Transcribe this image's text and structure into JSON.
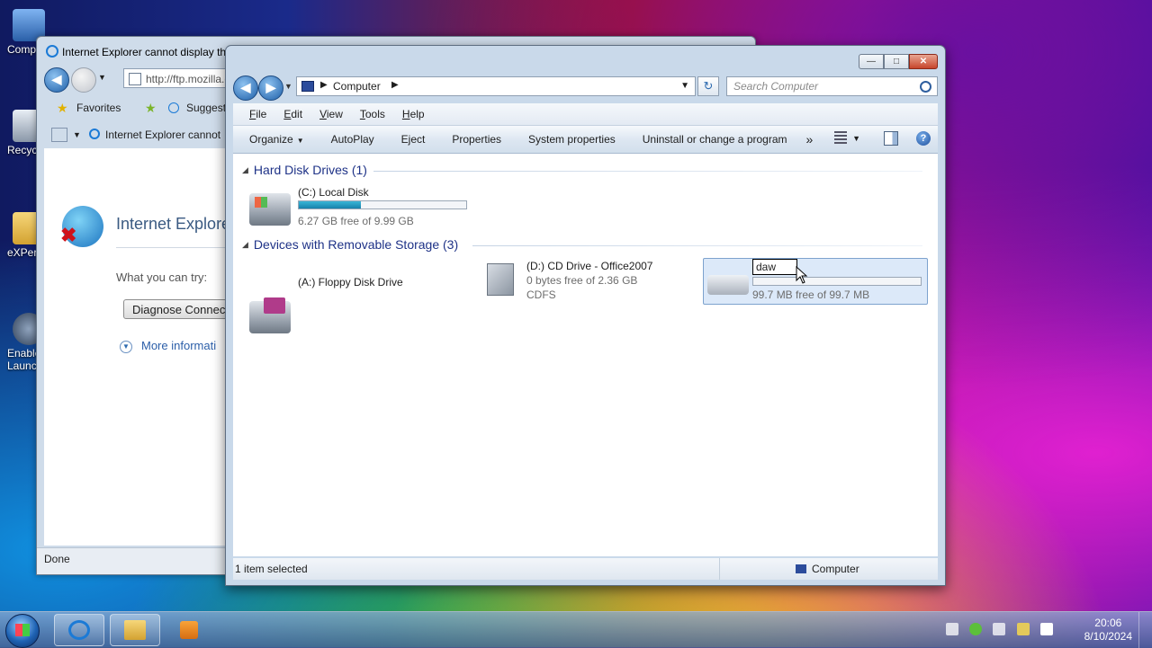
{
  "desktop": {
    "icons": [
      "Comp",
      "Recyc",
      "eXPer",
      "Enable\nLaunc"
    ]
  },
  "ie": {
    "title": "Internet Explorer cannot display th",
    "address": "http://ftp.mozilla.c",
    "favorites": "Favorites",
    "suggested": "Suggest",
    "tab_title": "Internet Explorer cannot",
    "page_heading": "Internet Explore",
    "what_try": "What you can try:",
    "diagnose": "Diagnose Connect",
    "more_info": "More informati",
    "status": "Done"
  },
  "explorer": {
    "breadcrumb": "Computer",
    "search_placeholder": "Search Computer",
    "menu": {
      "file_u": "F",
      "file_rest": "ile",
      "edit_u": "E",
      "edit_rest": "dit",
      "view_u": "V",
      "view_rest": "iew",
      "tools_u": "T",
      "tools_rest": "ools",
      "help_u": "H",
      "help_rest": "elp"
    },
    "commands": {
      "organize": "Organize",
      "autoplay": "AutoPlay",
      "eject": "Eject",
      "properties": "Properties",
      "system_properties": "System properties",
      "uninstall": "Uninstall or change a program",
      "more": "»"
    },
    "groups": {
      "hard_disk": "Hard Disk Drives (1)",
      "removable": "Devices with Removable Storage (3)"
    },
    "drives": {
      "c": {
        "name": "(C:) Local Disk",
        "free": "6.27 GB free of 9.99 GB",
        "used_fraction": 0.37
      },
      "a": {
        "name": "(A:) Floppy Disk Drive"
      },
      "d": {
        "name": "(D:) CD Drive - Office2007",
        "free": "0 bytes free of 2.36 GB",
        "fs": "CDFS"
      },
      "usb": {
        "rename_value": "daw",
        "free": "99.7 MB free of 99.7 MB",
        "used_fraction": 0.0
      }
    },
    "status_left": "1 item selected",
    "status_right": "Computer"
  },
  "taskbar": {
    "time": "20:06",
    "date": "8/10/2024"
  }
}
